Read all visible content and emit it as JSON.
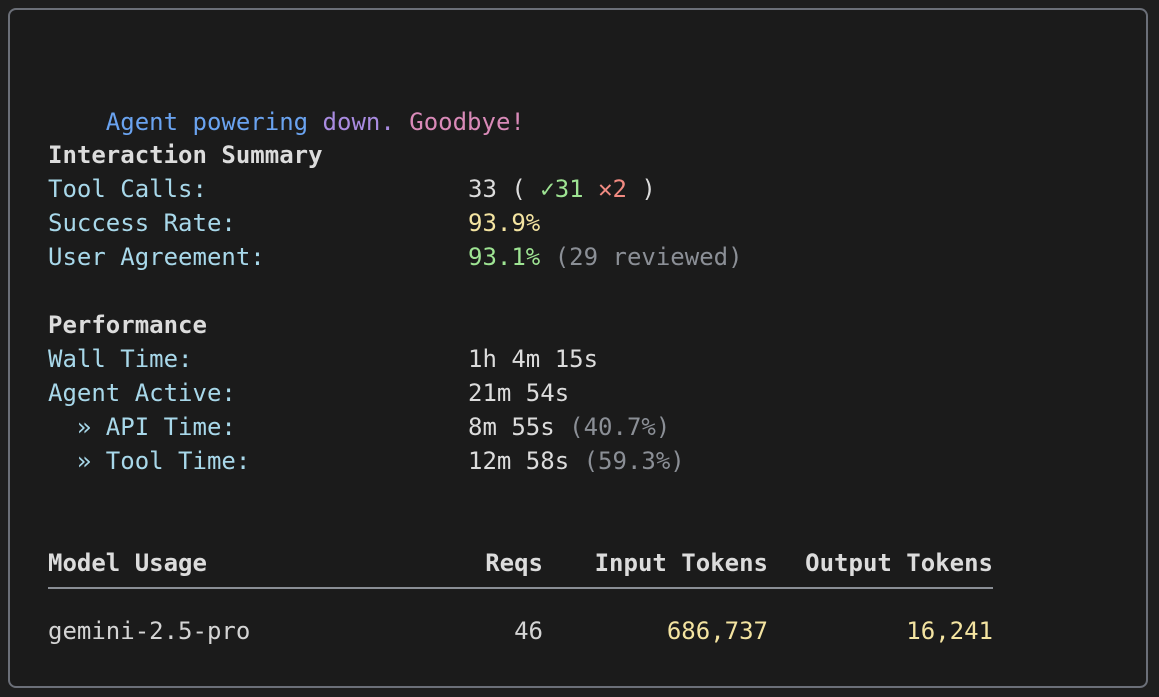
{
  "farewell": {
    "part1": "Agent powering ",
    "part2": "down. ",
    "part3": "Goodbye!"
  },
  "interaction": {
    "heading": "Interaction Summary",
    "tool_calls": {
      "label": "Tool Calls:",
      "total": "33 ( ",
      "check_icon": "✓",
      "success": "31",
      "cross_icon": "✕",
      "fail": "2",
      "close": " )"
    },
    "success_rate": {
      "label": "Success Rate:",
      "value": "93.9%"
    },
    "user_agreement": {
      "label": "User Agreement:",
      "value": "93.1%",
      "note": " (29 reviewed)"
    }
  },
  "performance": {
    "heading": "Performance",
    "wall_time": {
      "label": "Wall Time:",
      "value": "1h 4m 15s"
    },
    "agent_active": {
      "label": "Agent Active:",
      "value": "21m 54s"
    },
    "api_time": {
      "label": "  » API Time:",
      "value": "8m 55s",
      "pct": " (40.7%)"
    },
    "tool_time": {
      "label": "  » Tool Time:",
      "value": "12m 58s",
      "pct": " (59.3%)"
    }
  },
  "model_usage": {
    "headers": {
      "model": "Model Usage",
      "reqs": "Reqs",
      "input": "Input Tokens",
      "output": "Output Tokens"
    },
    "rows": [
      {
        "model": "gemini-2.5-pro",
        "reqs": "46",
        "input": "686,737",
        "output": "16,241"
      }
    ]
  },
  "colors": {
    "blue": "#6aa3f0",
    "purple": "#a98be0",
    "pink": "#d98ab8",
    "label": "#a8d8ea",
    "green": "#9ee493",
    "yellow": "#f4e4a1",
    "red": "#f28b82"
  }
}
